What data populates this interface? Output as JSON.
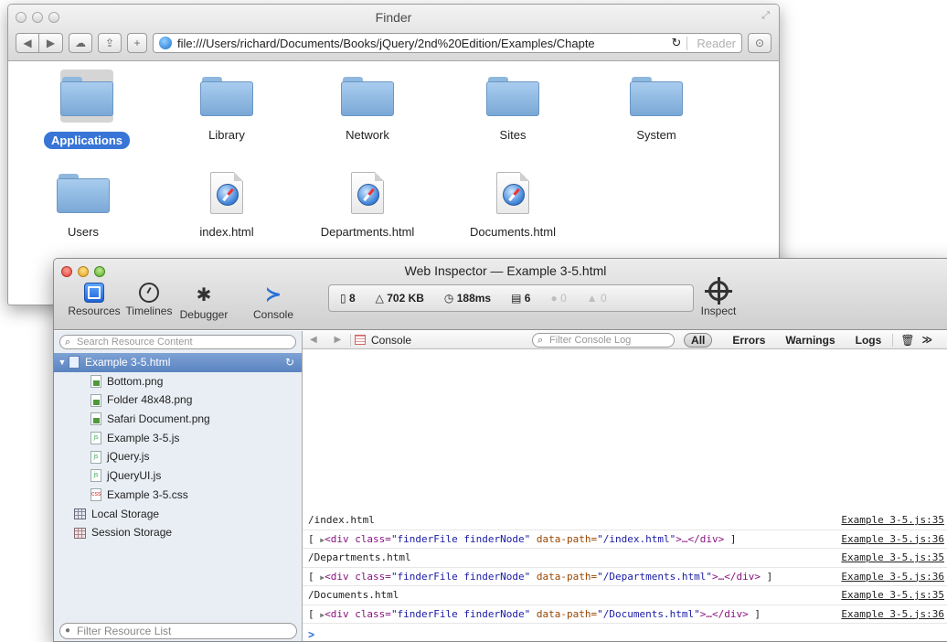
{
  "finder": {
    "title": "Finder",
    "url": "file:///Users/richard/Documents/Books/jQuery/2nd%20Edition/Examples/Chapte",
    "reader_label": "Reader",
    "items": [
      {
        "label": "Applications",
        "kind": "folder",
        "selected": true
      },
      {
        "label": "Library",
        "kind": "folder"
      },
      {
        "label": "Network",
        "kind": "folder"
      },
      {
        "label": "Sites",
        "kind": "folder"
      },
      {
        "label": "System",
        "kind": "folder"
      },
      {
        "label": "Users",
        "kind": "folder"
      },
      {
        "label": "index.html",
        "kind": "document"
      },
      {
        "label": "Departments.html",
        "kind": "document"
      },
      {
        "label": "Documents.html",
        "kind": "document"
      }
    ]
  },
  "inspector": {
    "title": "Web Inspector — Example 3-5.html",
    "tools": [
      {
        "label": "Resources",
        "icon": "resources-icon"
      },
      {
        "label": "Timelines",
        "icon": "timelines-icon"
      },
      {
        "label": "Debugger",
        "icon": "debugger-icon"
      },
      {
        "label": "Console",
        "icon": "console-icon"
      }
    ],
    "stats": {
      "resources": "8",
      "size": "702 KB",
      "time": "188ms",
      "logs": "6",
      "errors": "0",
      "warnings": "0"
    },
    "inspect_label": "Inspect",
    "sidebar": {
      "search_placeholder": "Search Resource Content",
      "filter_placeholder": "Filter Resource List",
      "root": "Example 3-5.html",
      "children": [
        {
          "label": "Bottom.png",
          "type": "img"
        },
        {
          "label": "Folder 48x48.png",
          "type": "img"
        },
        {
          "label": "Safari Document.png",
          "type": "img"
        },
        {
          "label": "Example 3-5.js",
          "type": "js"
        },
        {
          "label": "jQuery.js",
          "type": "js"
        },
        {
          "label": "jQueryUI.js",
          "type": "js"
        },
        {
          "label": "Example 3-5.css",
          "type": "css"
        }
      ],
      "storage": [
        "Local Storage",
        "Session Storage"
      ]
    },
    "console": {
      "tab_label": "Console",
      "filter_placeholder": "Filter Console Log",
      "levels": [
        "All",
        "Errors",
        "Warnings",
        "Logs"
      ],
      "rows": [
        {
          "text": "/index.html",
          "source": "Example 3-5.js:35"
        },
        {
          "path": "/index.html",
          "source": "Example 3-5.js:36",
          "element": true
        },
        {
          "text": "/Departments.html",
          "source": "Example 3-5.js:35"
        },
        {
          "path": "/Departments.html",
          "source": "Example 3-5.js:36",
          "element": true
        },
        {
          "text": "/Documents.html",
          "source": "Example 3-5.js:35"
        },
        {
          "path": "/Documents.html",
          "source": "Example 3-5.js:36",
          "element": true
        }
      ],
      "element_prefix": "<div class=",
      "element_class": "\"finderFile finderNode\"",
      "element_attr": " data-path=",
      "element_suffix": ">…</div>",
      "prompt": ">"
    }
  }
}
